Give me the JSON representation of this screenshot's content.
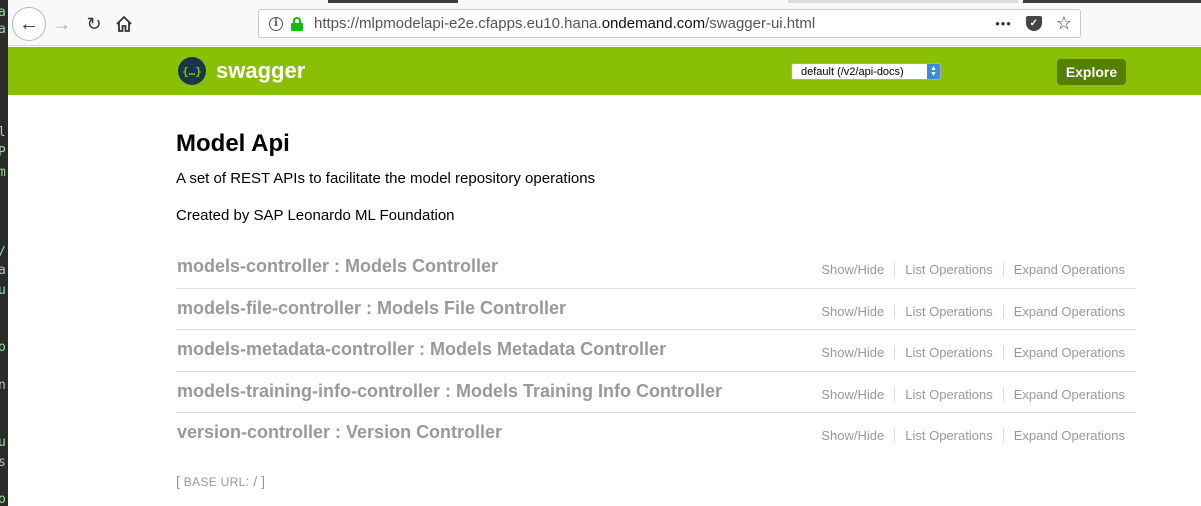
{
  "browser": {
    "url_prefix": "https://mlpmodelapi-e2e.cfapps.eu10.hana.",
    "url_domain": "ondemand.com",
    "url_path": "/swagger-ui.html",
    "more_label": "•••"
  },
  "header": {
    "logo_text": "swagger",
    "logo_glyph": "{…}",
    "api_select_value": "default (/v2/api-docs)",
    "explore_label": "Explore",
    "accent_color": "#89bf04"
  },
  "info": {
    "title": "Model Api",
    "description": "A set of REST APIs to facilitate the model repository operations",
    "created_by": "Created by SAP Leonardo ML Foundation"
  },
  "operations_labels": {
    "show_hide": "Show/Hide",
    "list": "List Operations",
    "expand": "Expand Operations"
  },
  "resources": [
    {
      "name": "models-controller : Models Controller"
    },
    {
      "name": "models-file-controller : Models File Controller"
    },
    {
      "name": "models-metadata-controller : Models Metadata Controller"
    },
    {
      "name": "models-training-info-controller : Models Training Info Controller"
    },
    {
      "name": "version-controller : Version Controller"
    }
  ],
  "base_url": {
    "open": "[ ",
    "label": "BASE URL",
    "value": ": / ]"
  }
}
